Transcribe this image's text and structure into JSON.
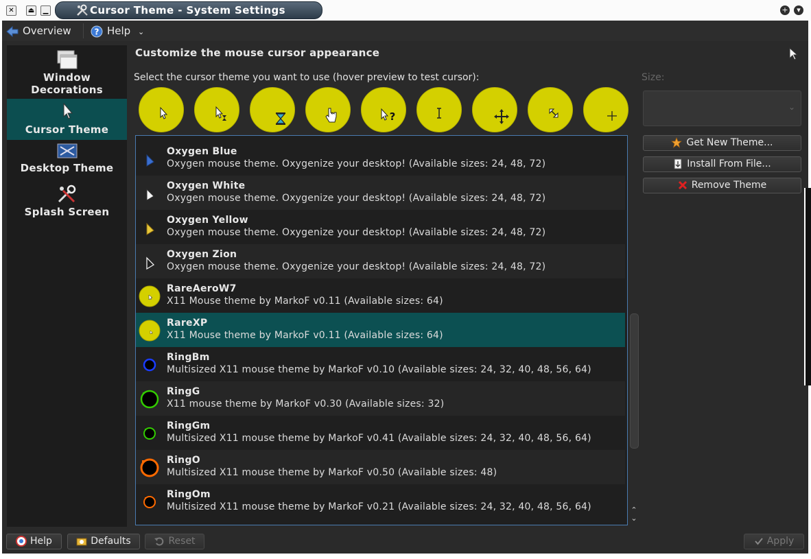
{
  "window": {
    "title": "Cursor Theme - System Settings",
    "buttons": [
      "close-icon",
      "keep-above-icon",
      "minimize-icon",
      "add-icon",
      "menu-icon"
    ]
  },
  "toolbar": {
    "overview_label": "Overview",
    "help_label": "Help"
  },
  "sidebar": {
    "items": [
      {
        "label": "Window\nDecorations",
        "icon": "window-decorations-icon",
        "selected": false
      },
      {
        "label": "Cursor Theme",
        "icon": "cursor-icon",
        "selected": true
      },
      {
        "label": "Desktop Theme",
        "icon": "desktop-theme-icon",
        "selected": false
      },
      {
        "label": "Splash Screen",
        "icon": "splash-screen-icon",
        "selected": false
      }
    ]
  },
  "main": {
    "heading": "Customize the mouse cursor appearance",
    "instruction": "Select the cursor theme you want to use (hover preview to test cursor):",
    "previews": [
      "arrow-cursor",
      "busy-cursor",
      "wait-cursor",
      "hand-cursor",
      "help-cursor",
      "text-cursor",
      "move-cursor",
      "resize-diagonal-cursor",
      "crosshair-cursor"
    ],
    "preview_color": "#d4d000",
    "themes": [
      {
        "name": "Oxygen Blue",
        "description": "Oxygen mouse theme. Oxygenize your desktop! (Available sizes: 24, 48, 72)",
        "icon": "blue-arrow"
      },
      {
        "name": "Oxygen White",
        "description": "Oxygen mouse theme. Oxygenize your desktop! (Available sizes: 24, 48, 72)",
        "icon": "white-arrow"
      },
      {
        "name": "Oxygen Yellow",
        "description": "Oxygen mouse theme. Oxygenize your desktop! (Available sizes: 24, 48, 72)",
        "icon": "yellow-arrow"
      },
      {
        "name": "Oxygen Zion",
        "description": "Oxygen mouse theme. Oxygenize your desktop! (Available sizes: 24, 48, 72)",
        "icon": "outline-arrow"
      },
      {
        "name": "RareAeroW7",
        "description": "X11 Mouse theme by MarkoF v0.11 (Available sizes: 64)",
        "icon": "yellow-circle"
      },
      {
        "name": "RareXP",
        "description": "X11 Mouse theme by MarkoF v0.11 (Available sizes: 64)",
        "icon": "yellow-circle",
        "selected": true
      },
      {
        "name": "RingBm",
        "description": "Multisized X11 mouse theme by MarkoF v0.10 (Available sizes: 24, 32, 40, 48, 56, 64)",
        "icon": "ring-blue-small",
        "ring_color": "#1a3cff"
      },
      {
        "name": "RingG",
        "description": "X11 mouse theme by MarkoF v0.30 (Available sizes: 32)",
        "icon": "ring-green-large",
        "ring_color": "#33cc00"
      },
      {
        "name": "RingGm",
        "description": "Multisized X11 mouse theme by MarkoF v0.41 (Available sizes: 24, 32, 40, 48, 56, 64)",
        "icon": "ring-green-small",
        "ring_color": "#33cc00"
      },
      {
        "name": "RingO",
        "description": "Multisized X11 mouse theme by MarkoF v0.50 (Available sizes: 48)",
        "icon": "ring-orange-large",
        "ring_color": "#ff6a00"
      },
      {
        "name": "RingOm",
        "description": "Multisized X11 mouse theme by MarkoF v0.21 (Available sizes: 24, 32, 40, 48, 56, 64)",
        "icon": "ring-orange-small",
        "ring_color": "#ff6a00"
      }
    ]
  },
  "right_panel": {
    "size_label": "Size:",
    "get_new_label": "Get New Theme...",
    "install_label": "Install From File...",
    "remove_label": "Remove Theme"
  },
  "bottom": {
    "help_label": "Help",
    "defaults_label": "Defaults",
    "reset_label": "Reset",
    "apply_label": "Apply"
  },
  "colors": {
    "accent": "#0c5052",
    "list_border": "#4a7bb0",
    "background": "#2a2a2a"
  }
}
